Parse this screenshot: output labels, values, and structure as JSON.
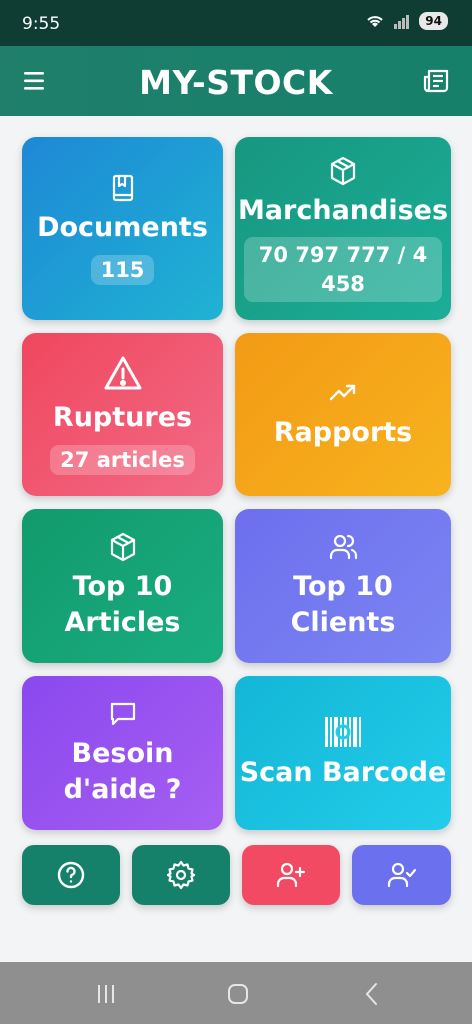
{
  "status_bar": {
    "time": "9:55",
    "battery": "94"
  },
  "app_bar": {
    "title": "MY-STOCK",
    "menu_icon": "menu-icon",
    "right_icon": "newspaper-icon"
  },
  "tiles": {
    "documents": {
      "label": "Documents",
      "badge": "115",
      "icon": "book-icon"
    },
    "marchandises": {
      "label": "Marchandises",
      "badge": "70 797 777 / 4 458",
      "icon": "box-icon"
    },
    "ruptures": {
      "label": "Ruptures",
      "badge": "27 articles",
      "icon": "warning-icon"
    },
    "rapports": {
      "label": "Rapports",
      "icon": "trending-up-icon"
    },
    "top_articles": {
      "label_line1": "Top 10",
      "label_line2": "Articles",
      "icon": "box-icon"
    },
    "top_clients": {
      "label_line1": "Top 10",
      "label_line2": "Clients",
      "icon": "users-icon"
    },
    "besoin_aide": {
      "label_line1": "Besoin",
      "label_line2": "d'aide ?",
      "icon": "chat-icon"
    },
    "scan_barcode": {
      "label": "Scan Barcode",
      "icon": "barcode-icon"
    }
  },
  "bottom_buttons": [
    {
      "icon": "help-circle-icon",
      "color": "#16816a"
    },
    {
      "icon": "gear-icon",
      "color": "#16816a"
    },
    {
      "icon": "user-plus-icon",
      "color": "#f24a63"
    },
    {
      "icon": "user-check-icon",
      "color": "#6a70ee"
    }
  ]
}
